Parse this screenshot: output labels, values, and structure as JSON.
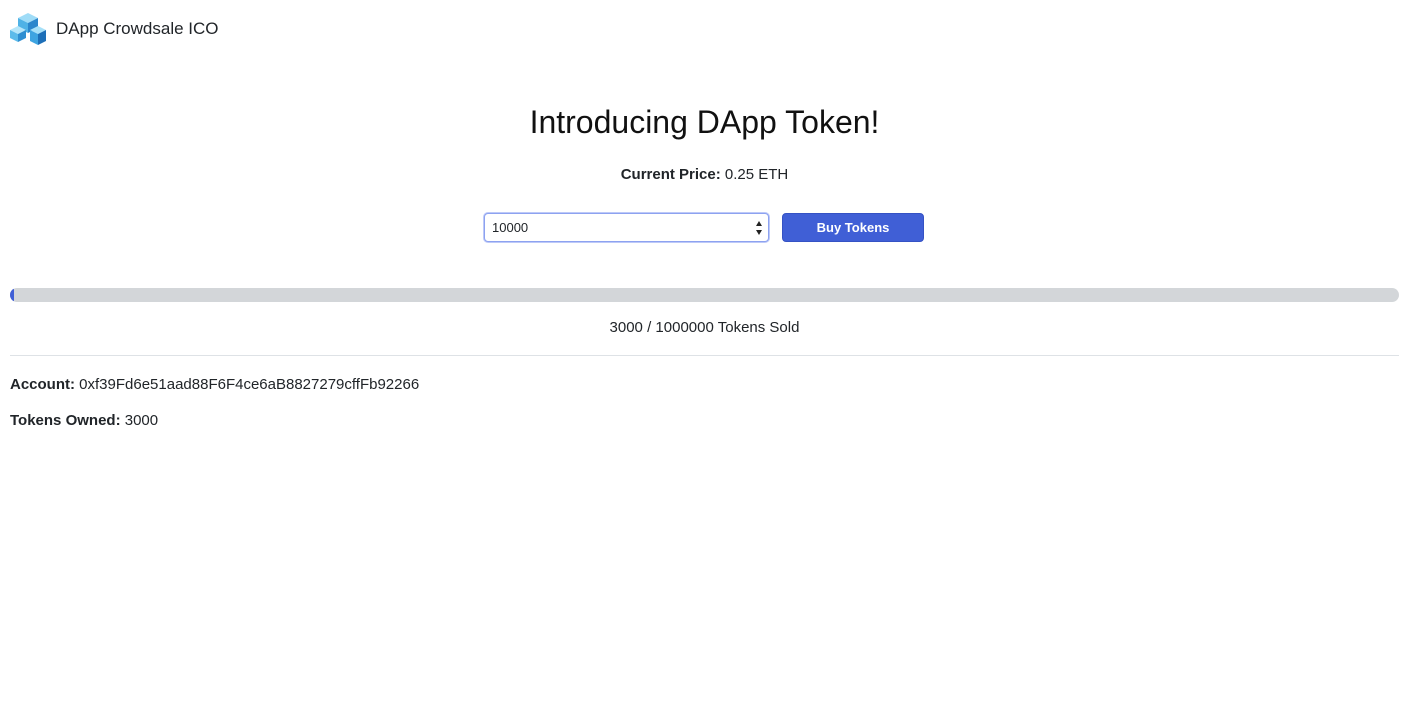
{
  "navbar": {
    "brand": "DApp Crowdsale ICO",
    "logo_icon": "cube-logo-icon"
  },
  "hero": {
    "title": "Introducing DApp Token!"
  },
  "price": {
    "label": "Current Price:",
    "value": "0.25 ETH"
  },
  "buy_form": {
    "amount_value": "10000",
    "button_label": "Buy Tokens"
  },
  "progress": {
    "fraction_sold": 0.003,
    "tokens_sold": "3000",
    "separator": "/",
    "max_tokens": "1000000",
    "suffix": "Tokens Sold"
  },
  "account": {
    "label": "Account:",
    "address": "0xf39Fd6e51aad88F6F4ce6aB8827279cffFb92266"
  },
  "tokens_owned": {
    "label": "Tokens Owned:",
    "value": "3000"
  },
  "colors": {
    "primary_button": "#405fd6",
    "progress_track": "#d3d6d9",
    "logo_light": "#7fd0f5",
    "logo_mid": "#3aa3e0",
    "logo_dark": "#1d6fb8"
  }
}
